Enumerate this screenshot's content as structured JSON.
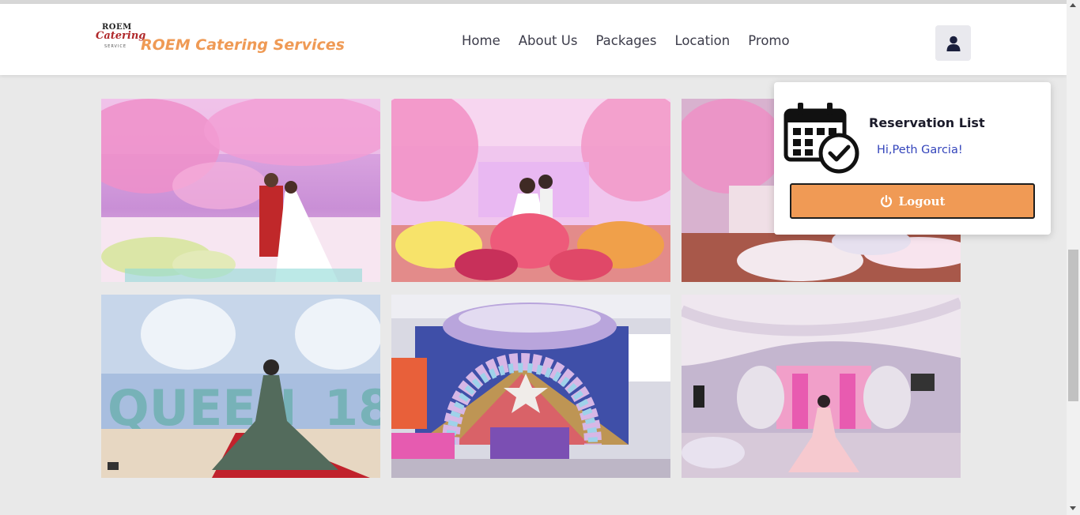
{
  "brand": {
    "logo_line1": "ROEM",
    "logo_line2": "Catering",
    "logo_line3": "SERVICE",
    "name": "ROEM Catering Services",
    "color": "#ef9a55"
  },
  "nav": {
    "items": [
      {
        "label": "Home"
      },
      {
        "label": "About Us"
      },
      {
        "label": "Packages"
      },
      {
        "label": "Location"
      },
      {
        "label": "Promo"
      }
    ]
  },
  "user_button": {
    "icon": "user-icon"
  },
  "gallery": {
    "photos": [
      {
        "name": "wedding-pink-blossom-hall"
      },
      {
        "name": "wedding-stage-flowers"
      },
      {
        "name": "wedding-blossom-stage"
      },
      {
        "name": "debut-queen-18"
      },
      {
        "name": "kids-party-balloon-arch"
      },
      {
        "name": "debut-draped-hall"
      }
    ]
  },
  "dropdown": {
    "icon": "calendar-check-icon",
    "title": "Reservation List",
    "greeting": "Hi,Peth Garcia!",
    "logout_label": "Logout",
    "logout_icon": "power-icon",
    "logout_color": "#f09a55"
  }
}
